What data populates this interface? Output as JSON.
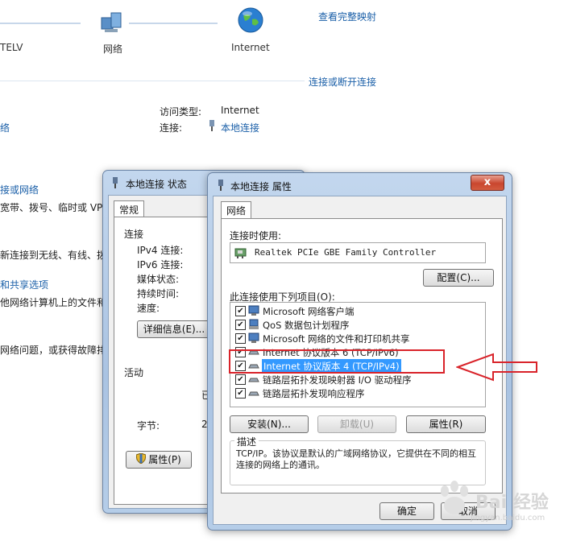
{
  "background": {
    "nodes": [
      "TELV",
      "网络",
      "Internet"
    ],
    "view_full_map": "查看完整映射",
    "connect_disconnect": "连接或断开连接",
    "access_type_label": "访问类型:",
    "access_type_value": "Internet",
    "connection_label": "连接:",
    "connection_value": "本地连接",
    "left_link": "络",
    "left_items": [
      "接或网络",
      "宽带、拨号、临时或 VP",
      "新连接到无线、有线、拨",
      "和共享选项",
      "他网络计算机上的文件和",
      "网络问题，或获得故障排"
    ]
  },
  "status_dialog": {
    "title": "本地连接 状态",
    "tab": "常规",
    "section_connection": "连接",
    "rows": [
      "IPv4 连接:",
      "IPv6 连接:",
      "媒体状态:",
      "持续时间:",
      "速度:"
    ],
    "details_button": "详细信息(E)...",
    "section_activity": "活动",
    "activity_partial": "已",
    "bytes_label": "字节:",
    "bytes_partial": "2",
    "properties_button": "属性(P)"
  },
  "properties_dialog": {
    "title": "本地连接 属性",
    "close_symbol": "x",
    "tab": "网络",
    "connect_using_label": "连接时使用:",
    "adapter": "Realtek PCIe GBE Family Controller",
    "configure_button": "配置(C)...",
    "items_label": "此连接使用下列项目(O):",
    "items": [
      {
        "label": "Microsoft 网络客户端",
        "checked": true
      },
      {
        "label": "QoS 数据包计划程序",
        "checked": true
      },
      {
        "label": "Microsoft 网络的文件和打印机共享",
        "checked": true
      },
      {
        "label": "Internet 协议版本 6 (TCP/IPv6)",
        "checked": true
      },
      {
        "label": "Internet 协议版本 4 (TCP/IPv4)",
        "checked": true,
        "selected": true
      },
      {
        "label": "链路层拓扑发现映射器 I/O 驱动程序",
        "checked": true
      },
      {
        "label": "链路层拓扑发现响应程序",
        "checked": true
      }
    ],
    "install_button": "安装(N)...",
    "uninstall_button": "卸载(U)",
    "properties_button": "属性(R)",
    "description_label": "描述",
    "description_text": "TCP/IP。该协议是默认的广域网络协议，它提供在不同的相互连接的网络上的通讯。",
    "ok_button": "确定",
    "cancel_button": "取消"
  },
  "annotation": {
    "highlight_color": "#d9232a"
  },
  "watermark": "Bai 经验",
  "watermark_url": "jingyan.baidu.com"
}
